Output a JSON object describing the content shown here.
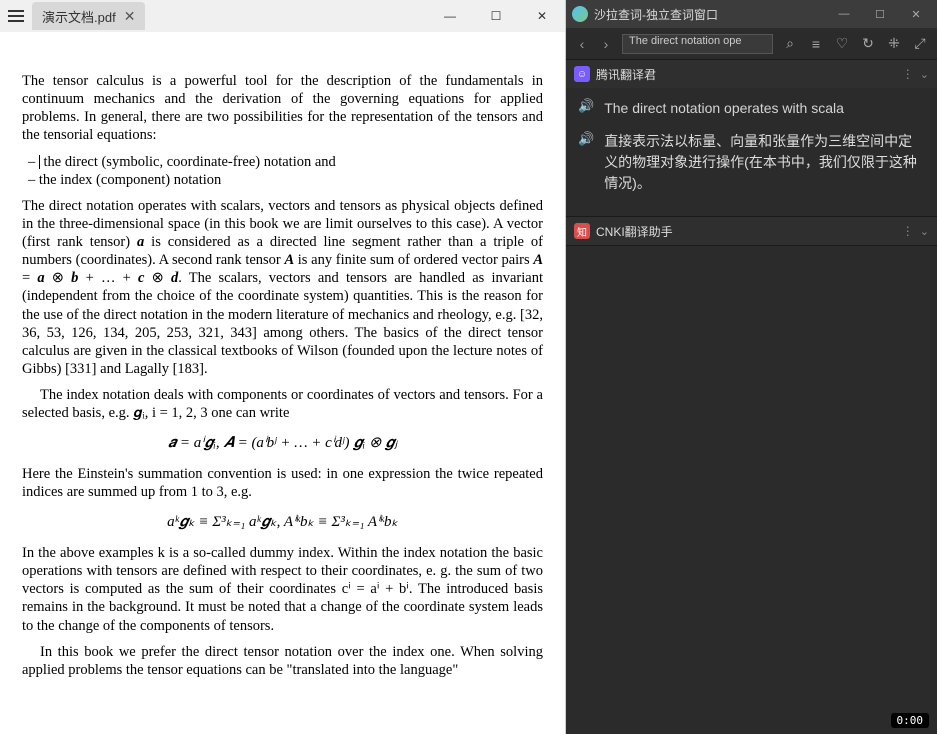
{
  "left": {
    "tab_title": "演示文档.pdf",
    "content": {
      "p1": "The tensor calculus is a powerful tool for the description of the fundamentals in continuum mechanics and the derivation of the governing equations for applied problems. In general, there are two possibilities for the representation of the tensors and the tensorial equations:",
      "li1": "the direct (symbolic, coordinate-free) notation and",
      "li2": "the index (component) notation",
      "p2a": "The direct notation operates with scalars, vectors and tensors as physical objects defined in the three-dimensional space (in this book we are limit ourselves to this case). A vector (first rank tensor) ",
      "p2b": " is considered as a directed line segment rather than a triple of numbers (coordinates). A second rank tensor ",
      "p2c": " is any finite sum of ordered vector pairs ",
      "p2d": ". The scalars, vectors and tensors are handled as invariant (independent from the choice of the coordinate system) quantities. This is the reason for the use of the direct notation in the modern literature of mechanics and rheology, e.g. [32, 36, 53, 126, 134, 205, 253, 321, 343] among others. The basics of the direct tensor calculus are given in the classical textbooks of Wilson (founded upon the lecture notes of Gibbs) [331] and Lagally [183].",
      "p3": "The index notation deals with components or coordinates of vectors and tensors. For a selected basis, e.g. 𝒈ᵢ, i = 1, 2, 3 one can write",
      "eq1": "𝒂 = aⁱ𝒈ᵢ,    𝑨 = (aⁱbʲ + … + cⁱdʲ) 𝒈ᵢ ⊗ 𝒈ⱼ",
      "p4": "Here the Einstein's summation convention is used: in one expression the twice repeated indices are summed up from 1 to 3, e.g.",
      "eq2": "aᵏ𝒈ₖ ≡ Σ³ₖ₌₁ aᵏ𝒈ₖ,    Aⁱᵏbₖ ≡ Σ³ₖ₌₁ Aⁱᵏbₖ",
      "p5": "In the above examples k is a so-called dummy index. Within the index notation the basic operations with tensors are defined with respect to their coordinates, e. g. the sum of two vectors is computed as the sum of their coordinates cⁱ = aⁱ + bⁱ. The introduced basis remains in the background. It must be noted that a change of the coordinate system leads to the change of the components of tensors.",
      "p6": "In this book we prefer the direct tensor notation over the index one. When solving applied problems the tensor equations can be \"translated into the language\""
    }
  },
  "right": {
    "window_title": "沙拉查词-独立查词窗口",
    "search_value": "The direct notation ope",
    "providers": {
      "tencent": {
        "name": "腾讯翻译君",
        "icon_text": "☺"
      },
      "cnki": {
        "name": "CNKI翻译助手",
        "icon_text": "知"
      }
    },
    "translation": {
      "en": "The direct notation operates with scala",
      "zh": "直接表示法以标量、向量和张量作为三维空间中定义的物理对象进行操作(在本书中，我们仅限于这种情况)。"
    },
    "timer": "0:00"
  }
}
